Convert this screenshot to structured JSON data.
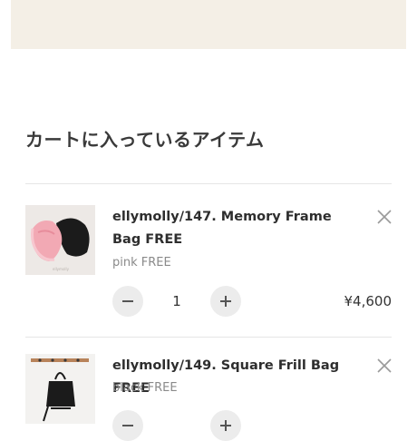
{
  "page": {
    "section_title": "カートに入っているアイテム"
  },
  "cart": {
    "items": [
      {
        "name": "ellymolly/147. Memory Frame Bag FREE",
        "variant": "pink FREE",
        "quantity": "1",
        "price": "¥4,600",
        "colors": {
          "bag_primary": "#f2a9b4",
          "bag_secondary": "#1b1b1b"
        }
      },
      {
        "name": "ellymolly/149. Square Frill Bag FREE",
        "variant": "black FREE",
        "colors": {
          "bag_primary": "#1b1b1b"
        }
      }
    ]
  },
  "colors": {
    "banner": "#f4efe6",
    "qty_button": "#ececec",
    "divider": "#e6e6e6",
    "title_text": "#3a3a3a",
    "muted_text": "#8a8a8a"
  },
  "icons": {
    "remove": "close-icon",
    "decrease": "minus-icon",
    "increase": "plus-icon"
  }
}
